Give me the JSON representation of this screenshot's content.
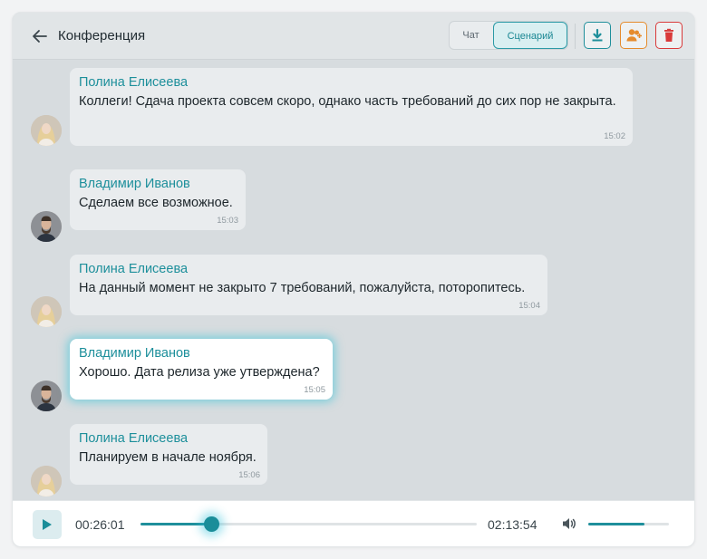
{
  "header": {
    "title": "Конференция",
    "segments": [
      {
        "label": "Чат",
        "selected": false
      },
      {
        "label": "Сценарий",
        "selected": true
      }
    ],
    "tools": [
      "download-icon",
      "add-user-icon",
      "trash-icon"
    ]
  },
  "messages": [
    {
      "author": "Полина Елисеева",
      "text": "Коллеги! Сдача проекта совсем скоро, однако часть требований до сих пор не закрыта.",
      "time": "15:02",
      "avatar": "female-avatar",
      "active": false
    },
    {
      "author": "Владимир Иванов",
      "text": "Сделаем все возможное.",
      "time": "15:03",
      "avatar": "male-avatar",
      "active": false
    },
    {
      "author": "Полина Елисеева",
      "text": "На данный момент не закрыто 7 требований, пожалуйста, поторопитесь.",
      "time": "15:04",
      "avatar": "female-avatar",
      "active": false
    },
    {
      "author": "Владимир Иванов",
      "text": "Хорошо. Дата релиза уже утверждена?",
      "time": "15:05",
      "avatar": "male-avatar",
      "active": true
    },
    {
      "author": "Полина Елисеева",
      "text": "Планируем в начале ноября.",
      "time": "15:06",
      "avatar": "female-avatar",
      "active": false
    }
  ],
  "player": {
    "current_time": "00:26:01",
    "total_time": "02:13:54",
    "progress_fraction": 0.21,
    "volume_fraction": 0.7,
    "accent_color": "#1f8f9b"
  }
}
